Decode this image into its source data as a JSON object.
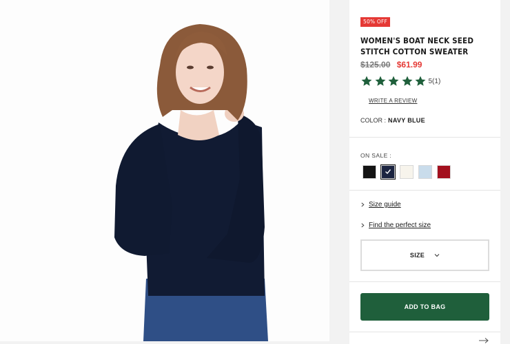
{
  "product": {
    "badge": "50% OFF",
    "title": "WOMEN'S BOAT NECK SEED STITCH COTTON SWEATER",
    "old_price": "$125.00",
    "new_price": "$61.99",
    "rating_value": 5,
    "rating_max": 5,
    "rating_count": "5(1)",
    "write_review": "WRITE A REVIEW",
    "color_label": "COLOR :",
    "color_value": "NAVY BLUE"
  },
  "variants": {
    "label": "ON SALE :",
    "swatches": [
      {
        "name": "black",
        "color": "#141414",
        "selected": false
      },
      {
        "name": "navy-blue",
        "color": "#1b2440",
        "selected": true
      },
      {
        "name": "cream",
        "color": "#f7f4ec",
        "selected": false
      },
      {
        "name": "light-blue",
        "color": "#c9dceb",
        "selected": false
      },
      {
        "name": "red",
        "color": "#a3101e",
        "selected": false
      }
    ]
  },
  "links": {
    "size_guide": "Size guide",
    "perfect_size": "Find the perfect size"
  },
  "size_select": {
    "label": "SIZE"
  },
  "add_to_bag": "ADD TO BAG",
  "colors": {
    "accent_green": "#1f5f3b",
    "sale_red": "#e53935",
    "star_green": "#1f5f3b"
  },
  "icons": {
    "star": "star-icon",
    "check": "check-icon",
    "chevron_right": "chevron-right-icon",
    "chevron_down": "chevron-down-icon",
    "next_arrow": "arrow-right-icon"
  }
}
